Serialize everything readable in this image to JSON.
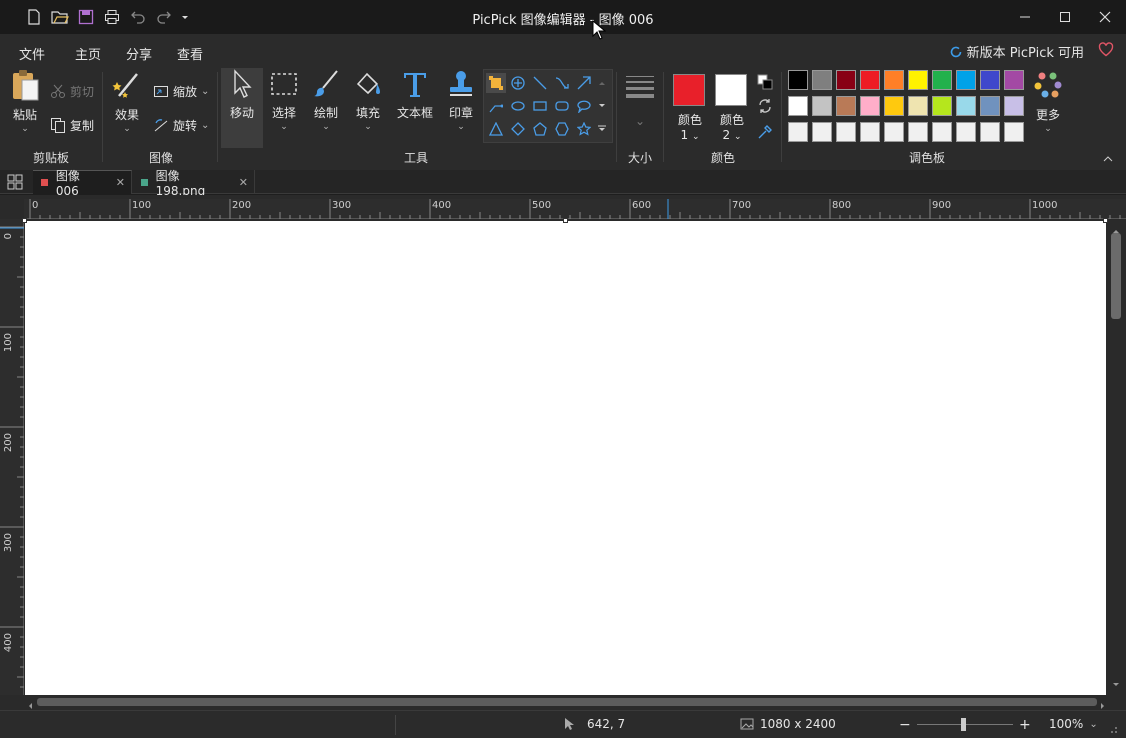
{
  "window": {
    "title": "PicPick 图像编辑器 - 图像 006"
  },
  "menu": {
    "tabs": [
      "文件",
      "主页",
      "分享",
      "查看"
    ],
    "active": "主页",
    "update_notice": "新版本 PicPick 可用"
  },
  "ribbon": {
    "clipboard": {
      "paste": "粘贴",
      "cut": "剪切",
      "copy": "复制",
      "group": "剪贴板"
    },
    "image": {
      "effects": "效果",
      "resize": "缩放",
      "rotate": "旋转",
      "group": "图像"
    },
    "tools": {
      "move": "移动",
      "select": "选择",
      "draw": "绘制",
      "fill": "填充",
      "textbox": "文本框",
      "stamp": "印章",
      "group": "工具"
    },
    "size": {
      "group": "大小"
    },
    "colors": {
      "color1": "颜色",
      "color1_num": "1",
      "color2": "颜色",
      "color2_num": "2",
      "group": "颜色",
      "color1_value": "#e8202a",
      "color2_value": "#ffffff"
    },
    "palette": {
      "group": "调色板",
      "more": "更多",
      "row1": [
        "#000000",
        "#7f7f7f",
        "#880015",
        "#ed1c24",
        "#ff7f27",
        "#fff200",
        "#22b14c",
        "#00a2e8",
        "#3f48cc",
        "#a349a4"
      ],
      "row2": [
        "#ffffff",
        "#c3c3c3",
        "#b97a57",
        "#ffaec9",
        "#ffc90e",
        "#efe4b0",
        "#b5e61d",
        "#99d9ea",
        "#7092be",
        "#c8bfe7"
      ],
      "row3": [
        "#f0f0f0",
        "#f0f0f0",
        "#f0f0f0",
        "#f0f0f0",
        "#f0f0f0",
        "#f0f0f0",
        "#f0f0f0",
        "#f0f0f0",
        "#f0f0f0",
        "#f0f0f0"
      ]
    }
  },
  "doc_tabs": [
    {
      "label": "图像 006",
      "color": "#e05050"
    },
    {
      "label": "图像 198.png",
      "color": "#4aa58a"
    }
  ],
  "rulers": {
    "horizontal": [
      "0",
      "100",
      "200",
      "300",
      "400",
      "500",
      "600",
      "700",
      "800",
      "900",
      "1000"
    ],
    "vertical": [
      "0",
      "100",
      "200",
      "300",
      "400"
    ]
  },
  "status": {
    "cursor": "642, 7",
    "image_size": "1080 x 2400",
    "zoom": "100%",
    "zoom_minus": "−",
    "zoom_plus": "+"
  }
}
